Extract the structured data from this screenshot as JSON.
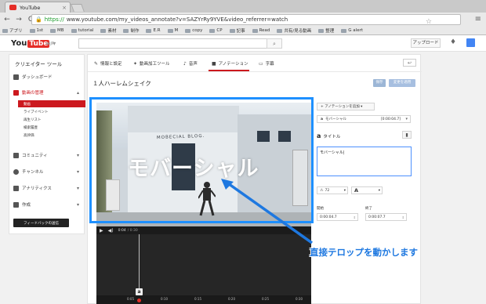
{
  "browser": {
    "tab_title": "YouTube",
    "tab_close": "×",
    "url_scheme": "https://",
    "url_rest": "www.youtube.com/my_videos_annotate?v=SAZYrRy9YVE&video_referrer=watch",
    "back_icon": "←",
    "forward_icon": "→",
    "reload_icon": "C",
    "star_icon": "☆",
    "menu_icon": "≡",
    "bookmarks": [
      "アプリ",
      "1st",
      "MB",
      "tutorial",
      "素材",
      "制作",
      "E.R",
      "M",
      "copy",
      "CP",
      "記事",
      "Read",
      "共有/見る動画",
      "整理",
      "G alert"
    ]
  },
  "yt_header": {
    "logo_you": "You",
    "logo_tube": "Tube",
    "logo_region": "JP",
    "guide_icon": "≡ ▾",
    "search_icon": "⌕",
    "upload_label": "アップロード",
    "bell_icon": "🔔"
  },
  "sidebar": {
    "title": "クリエイター ツール",
    "dashboard": "ダッシュボード",
    "video_manager": "動画の管理",
    "sub": [
      "動画",
      "ライブイベント",
      "再生リスト",
      "検索履歴",
      "高評価"
    ],
    "community": "コミュニティ",
    "channel": "チャンネル",
    "analytics": "アナリティクス",
    "create": "作成",
    "feedback": "フィードバックの送信"
  },
  "editor_tabs": {
    "info": "情報と設定",
    "enhance": "動画加工ツール",
    "audio": "音声",
    "annotations": "アノテーション",
    "subtitles": "字幕",
    "undo_icon": "↩"
  },
  "video": {
    "title": "１人ハーレムシェイク",
    "save_label": "保存",
    "publish_label": "変更を適用",
    "overlay_text": "モバーシャル",
    "sign_text": "MOBECIAL BLOG.",
    "play_icon": "▶",
    "volume_icon": "◀)",
    "current_time": "0:04",
    "duration": "/ 0:30"
  },
  "timeline": {
    "ticks": [
      "0:05",
      "0:10",
      "0:15",
      "0:20",
      "0:25",
      "0:30"
    ],
    "annot_letter": "a"
  },
  "panel": {
    "add_annotation": "アノテーションを追加",
    "selected_name": "モバーシャル",
    "selected_time": "[0:00:04.7]",
    "type_label": "タイトル",
    "trash_icon": "🗑",
    "text_value": "モバーシャル|",
    "font_size": "72",
    "font_color_label": "A",
    "start_label": "開始",
    "end_label": "終了",
    "start_time": "0:00:04.7",
    "end_time": "0:00:07.7"
  },
  "callout": {
    "text": "直接テロップを動かします"
  },
  "colors": {
    "accent_red": "#cc181e",
    "annotation_blue": "#1e90ff",
    "callout_blue": "#1e78e0"
  }
}
